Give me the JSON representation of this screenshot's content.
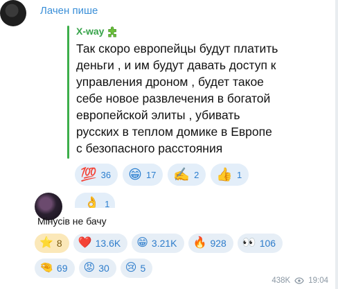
{
  "header": {
    "author": "Лачен пише"
  },
  "quote": {
    "author": "X-way",
    "author_icon": "puzzle-icon",
    "text": "Так скоро европейцы будут платить\nденьги , и им будут давать доступ к\nуправления дроном , будет такое\nсебе новое развлечения в богатой\nевропейской элиты , убивать\nрусских в теплом домике в Европе\nс безопасного расстояния",
    "reactions": [
      {
        "emoji": "💯",
        "count": "36"
      },
      {
        "emoji": "😁",
        "count": "17"
      },
      {
        "emoji": "✍️",
        "count": "2"
      },
      {
        "emoji": "👍",
        "count": "1"
      }
    ],
    "reaction_partial": {
      "emoji": "👌",
      "count": "1"
    }
  },
  "message": {
    "text": "Мінусів не бачу",
    "reactions": [
      {
        "emoji": "⭐",
        "count": "8",
        "selected": true
      },
      {
        "emoji": "❤️",
        "count": "13.6K"
      },
      {
        "emoji": "😁",
        "count": "3.21K"
      },
      {
        "emoji": "🔥",
        "count": "928"
      },
      {
        "emoji": "👀",
        "count": "106"
      },
      {
        "emoji": "🤏",
        "count": "69"
      },
      {
        "emoji": "😡",
        "count": "30"
      },
      {
        "emoji": "😢",
        "count": "5"
      }
    ],
    "views": "438K",
    "time": "19:04"
  },
  "colors": {
    "accent": "#3a8fd8",
    "quote_green": "#37a34a"
  }
}
